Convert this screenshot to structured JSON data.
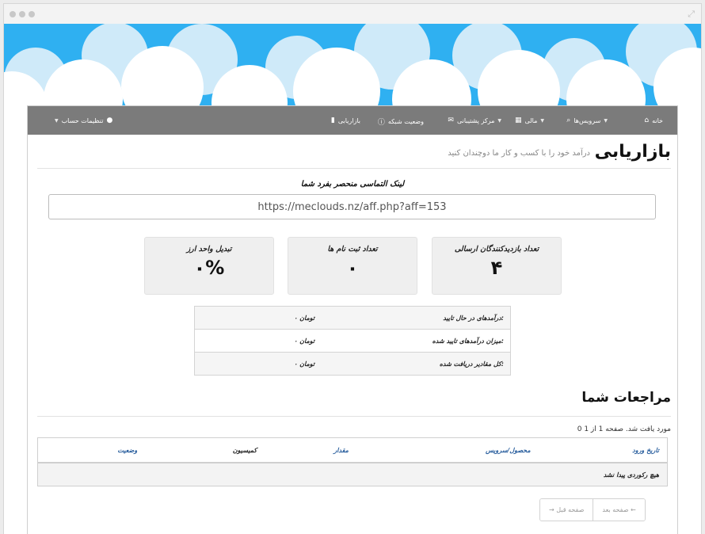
{
  "nav": {
    "items": [
      {
        "label": "خانه",
        "icon": "home-icon"
      },
      {
        "label": "سرویس‌ها",
        "icon": "search-icon"
      },
      {
        "label": "مالی",
        "icon": "bank-icon"
      },
      {
        "label": "مرکز پشتیبانی",
        "icon": "envelope-icon"
      },
      {
        "label": "وضعیت شبکه",
        "icon": "info-icon"
      },
      {
        "label": "بازاریابی",
        "icon": "chart-icon"
      },
      {
        "label": "تنظیمات حساب",
        "icon": "user-icon"
      }
    ]
  },
  "header": {
    "title": "بازاریابی",
    "subtitle": "درآمد خود را با کسب و کار ما دوچندان کنید"
  },
  "link": {
    "title": "لینک التماسی منحصر بفرد شما",
    "url": "https://meclouds.nz/aff.php?aff=153"
  },
  "stats": [
    {
      "label": "تعداد بازدیدکنندگان ارسالی",
      "value": "۴"
    },
    {
      "label": "تعداد ثبت نام ها",
      "value": "۰"
    },
    {
      "label": "تبدیل واحد ارز",
      "value": "۰%"
    }
  ],
  "summary": [
    {
      "label": "درآمدهای در حال تایید:",
      "value": "۰ تومان"
    },
    {
      "label": "میزان درآمدهای تایید شده:",
      "value": "۰ تومان"
    },
    {
      "label": "کل مقادیر دریافت شده:",
      "value": "۰ تومان"
    }
  ],
  "referrals": {
    "title": "مراجعات شما",
    "found_text": "0 مورد یافت شد. صفحه 1 از 1",
    "columns": [
      "تاریخ ورود",
      "محصول/سرویس",
      "مقدار",
      "کمیسیون",
      "وضعیت"
    ],
    "empty": "هیچ رکوردی پیدا نشد"
  },
  "pagination": {
    "next": "صفحه بعد ←",
    "prev": "→ صفحه قبل"
  },
  "colors": {
    "sky": "#2fb0f1",
    "nav": "#7b7b7b",
    "link_header": "#2a5f9e"
  }
}
